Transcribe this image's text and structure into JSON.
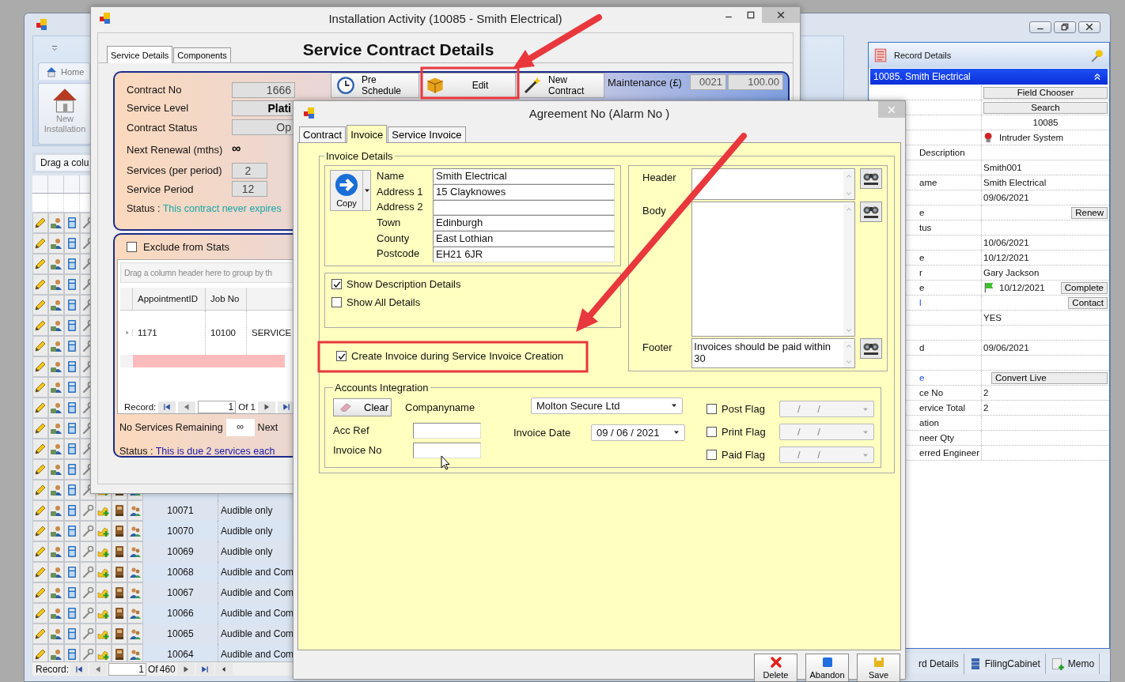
{
  "main_window": {
    "ribbon": {
      "tab": "Home",
      "button": "New Installation"
    },
    "group_panel": "Drag a colu",
    "grid": {
      "rows": [
        {
          "kind": "icons"
        },
        {
          "kind": "icons"
        },
        {
          "kind": "icons"
        },
        {
          "kind": "icons"
        },
        {
          "kind": "icons"
        },
        {
          "kind": "icons"
        },
        {
          "kind": "icons"
        },
        {
          "kind": "icons"
        },
        {
          "kind": "icons"
        },
        {
          "kind": "icons"
        },
        {
          "kind": "icons"
        },
        {
          "kind": "icons"
        },
        {
          "kind": "icons"
        },
        {
          "kind": "icons"
        },
        {
          "kind": "record",
          "id": "10071",
          "description": "Audible only"
        },
        {
          "kind": "record",
          "id": "10070",
          "description": "Audible only"
        },
        {
          "kind": "record",
          "id": "10069",
          "description": "Audible only"
        },
        {
          "kind": "record",
          "id": "10068",
          "description": "Audible and Com"
        },
        {
          "kind": "record",
          "id": "10067",
          "description": "Audible and Com"
        },
        {
          "kind": "record",
          "id": "10066",
          "description": "Audible and Com"
        },
        {
          "kind": "record",
          "id": "10065",
          "description": "Audible and Com"
        },
        {
          "kind": "record",
          "id": "10064",
          "description": "Audible and Com"
        }
      ],
      "pager": {
        "label": "Record:",
        "current": "1",
        "of": "Of",
        "total": "460"
      }
    },
    "record_details": {
      "title": "Record Details",
      "record": "10085. Smith Electrical",
      "rows": [
        {
          "kind": "button",
          "value": "Field Chooser"
        },
        {
          "kind": "button",
          "value": "Search"
        },
        {
          "kind": "center",
          "value": "10085"
        },
        {
          "kind": "alarm",
          "value": "Intruder System"
        },
        {
          "kind": "text",
          "label": "Description",
          "link": false
        },
        {
          "kind": "text",
          "value": "Smith001"
        },
        {
          "kind": "text",
          "label": "ame",
          "link": false,
          "value": "Smith Electrical"
        },
        {
          "kind": "text",
          "value": "09/06/2021"
        },
        {
          "kind": "button_right",
          "label": "e",
          "link": false,
          "value": "Renew"
        },
        {
          "kind": "text",
          "label": "tus",
          "link": false
        },
        {
          "kind": "text",
          "value": "10/06/2021"
        },
        {
          "kind": "text",
          "label": "e",
          "link": false,
          "value": "10/12/2021"
        },
        {
          "kind": "text",
          "label": "r",
          "link": false,
          "value": "Gary Jackson"
        },
        {
          "kind": "flag",
          "label": "e",
          "link": false,
          "value": "10/12/2021",
          "button": "Complete"
        },
        {
          "kind": "button_right",
          "label": "l",
          "link": true,
          "value": "Contact"
        },
        {
          "kind": "text",
          "value": "YES"
        },
        {
          "kind": "text"
        },
        {
          "kind": "text",
          "label": "d",
          "link": false,
          "value": "09/06/2021"
        },
        {
          "kind": "text"
        },
        {
          "kind": "button_left",
          "label": "e",
          "link": true,
          "value": "Convert Live"
        },
        {
          "kind": "text",
          "label": "ce No",
          "link": false,
          "value": "2"
        },
        {
          "kind": "text",
          "label": "ervice Total",
          "link": false,
          "value": "2"
        },
        {
          "kind": "text",
          "label": "ation",
          "link": false
        },
        {
          "kind": "text",
          "label": "neer Qty",
          "link": false
        },
        {
          "kind": "text",
          "label": "erred Engineer",
          "link": false
        }
      ]
    },
    "bottom_tabs": [
      "rd Details",
      "FilingCabinet",
      "Memo"
    ]
  },
  "installation_window": {
    "title": "Installation Activity (10085 - Smith Electrical)",
    "tabs": [
      {
        "label": "Service Details",
        "selected": true
      },
      {
        "label": "Components",
        "selected": false
      }
    ],
    "heading": "Service Contract Details",
    "fields": [
      {
        "label": "Contract No",
        "value": "1666",
        "kind": "box"
      },
      {
        "label": "Service Level",
        "value": "Plati",
        "kind": "bold"
      },
      {
        "label": "Contract Status",
        "value": "Op",
        "kind": "box"
      },
      {
        "label": "Next Renewal (mths)",
        "value": "∞",
        "kind": "plain"
      },
      {
        "label": "Services (per period)",
        "value": "2",
        "kind": "small"
      },
      {
        "label": "Service Period",
        "value": "12",
        "kind": "small"
      }
    ],
    "status": {
      "label": "Status :",
      "text": "This contract never expires"
    },
    "toolbar": [
      "Pre Schedule",
      "Edit",
      "New Contract"
    ],
    "charges": [
      {
        "label": "Maintenance (£)",
        "code": "0021",
        "amount": "100.00"
      }
    ],
    "exclude_from_stats": {
      "label": "Exclude from Stats",
      "checked": false
    },
    "grid": {
      "group_hint": "Drag a column header here to group by th",
      "columns": [
        "AppointmentID",
        "Job No"
      ],
      "rows": [
        [
          "1171",
          "10100",
          "SERVICE"
        ]
      ],
      "pager": {
        "label": "Record:",
        "current": "1",
        "of": "Of",
        "total": "1"
      }
    },
    "remaining": {
      "label": "No Services Remaining",
      "value": "∞",
      "next": "Next"
    },
    "due_status": {
      "label": "Status :",
      "text": "This is due 2 services each"
    }
  },
  "agreement_dialog": {
    "title": "Agreement No  (Alarm No )",
    "tabs": [
      {
        "label": "Contract",
        "selected": false
      },
      {
        "label": "Invoice",
        "selected": true
      },
      {
        "label": "Service Invoice",
        "selected": false
      }
    ],
    "invoice_details": {
      "title": "Invoice Details",
      "copy": "Copy",
      "address": [
        {
          "label": "Name",
          "value": "Smith Electrical"
        },
        {
          "label": "Address 1",
          "value": "15 Clayknowes"
        },
        {
          "label": "Address 2"
        },
        {
          "label": "Town",
          "value": "Edinburgh"
        },
        {
          "label": "County",
          "value": "East Lothian"
        },
        {
          "label": "Postcode",
          "value": "EH21 6JR"
        }
      ],
      "options": [
        {
          "label": "Show Description Details",
          "checked": true
        },
        {
          "label": "Show All Details",
          "checked": false
        }
      ],
      "create_invoice": {
        "label": "Create Invoice during Service Invoice Creation",
        "checked": true
      },
      "texts": [
        {
          "label": "Header"
        },
        {
          "label": "Body"
        },
        {
          "label": "Footer",
          "value": "Invoices should be paid within 30"
        }
      ]
    },
    "accounts": {
      "title": "Accounts Integration",
      "clear": "Clear",
      "company_label": "Companyname",
      "company": "Molton Secure Ltd",
      "acc_ref": "Acc Ref",
      "invoice_no": "Invoice No",
      "date_label": "Invoice Date",
      "date": "09 /  06 /  2021",
      "flags": [
        {
          "label": "Post Flag",
          "checked": false,
          "date": "/      /"
        },
        {
          "label": "Print Flag",
          "checked": false,
          "date": "/      /"
        },
        {
          "label": "Paid Flag",
          "checked": false,
          "date": "/      /"
        }
      ]
    },
    "buttons": [
      "Delete",
      "Abandon",
      "Save"
    ]
  }
}
